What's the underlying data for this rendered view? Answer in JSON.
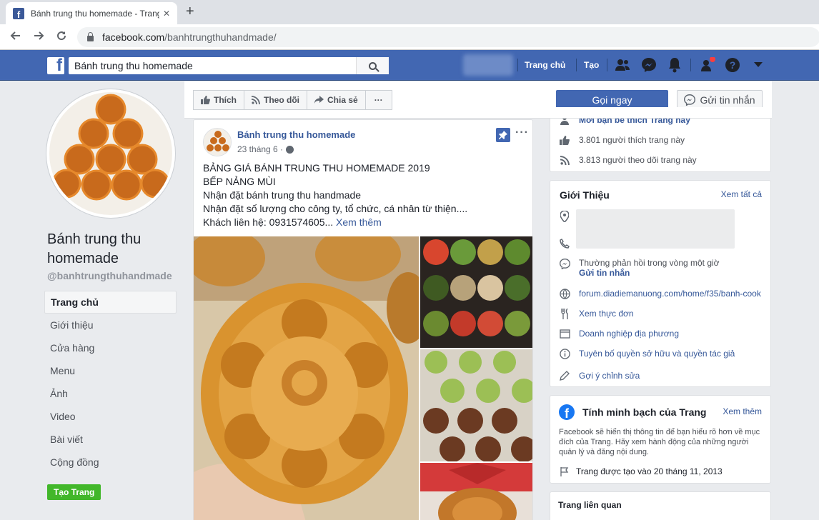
{
  "browser": {
    "tab_title": "Bánh trung thu homemade - Trang",
    "tab_close": "✕",
    "new_tab": "+",
    "url_host": "facebook.com",
    "url_path": "/banhtrungthuhandmade/"
  },
  "fb_header": {
    "search_value": "Bánh trung thu homemade",
    "nav_home": "Trang chủ",
    "nav_create": "Tạo",
    "brand_color": "#4267b2"
  },
  "page": {
    "name": "Bánh trung thu homemade",
    "handle": "@banhtrungthuhandmade"
  },
  "sidebar": {
    "items": [
      {
        "label": "Trang chủ"
      },
      {
        "label": "Giới thiệu"
      },
      {
        "label": "Cửa hàng"
      },
      {
        "label": "Menu"
      },
      {
        "label": "Ảnh"
      },
      {
        "label": "Video"
      },
      {
        "label": "Bài viết"
      },
      {
        "label": "Cộng đồng"
      }
    ],
    "create_page": "Tạo Trang"
  },
  "actions": {
    "like": "Thích",
    "follow": "Theo dõi",
    "share": "Chia sẻ",
    "more": "···",
    "call": "Gọi ngay",
    "message": "Gửi tin nhắn"
  },
  "post": {
    "author": "Bánh trung thu homemade",
    "date": "23 tháng 6 ·",
    "lines": [
      "BẢNG GIÁ BÁNH TRUNG THU HOMEMADE 2019",
      "BẾP NẢNG MÙI",
      "Nhận đặt bánh trung thu handmade",
      "Nhận đặt số lượng cho công ty, tổ chức, cá nhân từ thiện....",
      "Khách liên hệ: 0931574605..."
    ],
    "see_more": "Xem thêm"
  },
  "stats": {
    "friends_like": "Mời bạn bè thích Trang này",
    "likes": "3.801 người thích trang này",
    "follows": "3.813 người theo dõi trang này"
  },
  "about": {
    "title": "Giới Thiệu",
    "see_all": "Xem tất cả",
    "response": "Thường phản hồi trong vòng một giờ",
    "send_message": "Gửi tin nhắn",
    "website": "forum.diadiemanuong.com/home/f35/banh-cook",
    "menu": "Xem thực đơn",
    "category": "Doanh nghiệp địa phương",
    "ip": "Tuyên bố quyền sở hữu và quyền tác giả",
    "suggest": "Gợi ý chỉnh sửa"
  },
  "transparency": {
    "title": "Tính minh bạch của Trang",
    "see_more": "Xem thêm",
    "description": "Facebook sẽ hiển thị thông tin để bạn hiểu rõ hơn về mục đích của Trang. Hãy xem hành động của những người quản lý và đăng nội dung.",
    "created": "Trang được tạo vào 20 tháng 11, 2013"
  },
  "related": {
    "title": "Trang liên quan"
  }
}
